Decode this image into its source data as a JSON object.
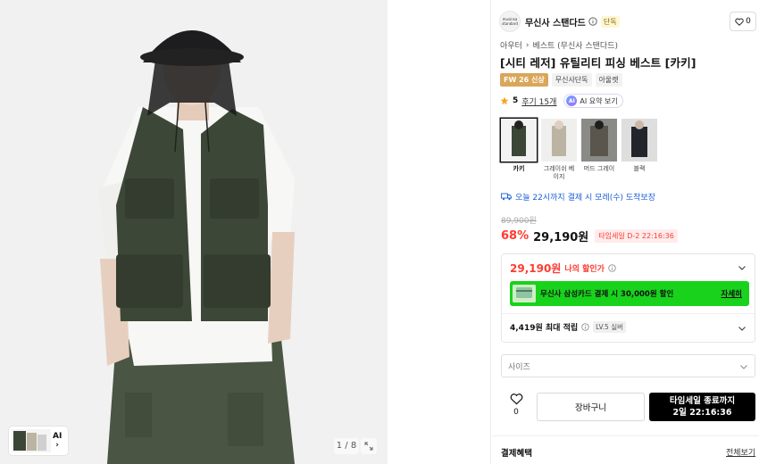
{
  "gallery": {
    "counter": "1 / 8",
    "thumb_ai_label": "AI"
  },
  "brand": {
    "logo_text": "musinsa standard",
    "name": "무신사 스탠다드",
    "exclusive_badge": "단독",
    "like_count": "0"
  },
  "breadcrumb": {
    "items": [
      "아우터",
      "베스트 (무신사 스탠다드)"
    ]
  },
  "product": {
    "title": "[시티 레저] 유틸리티 피싱 베스트 [카키]",
    "tags": [
      "FW 26 신상",
      "무신사단독",
      "아울렛"
    ],
    "rating": "5",
    "reviews": "후기 15개",
    "ai_summary": "AI 요약 보기",
    "ai_icon": "AI"
  },
  "colors": [
    {
      "label": "카키",
      "selected": true,
      "swatch": "#3b4636"
    },
    {
      "label": "그레이쉬 베이지",
      "selected": false,
      "swatch": "#bcb4a3"
    },
    {
      "label": "머드 그레이",
      "selected": false,
      "swatch": "#5a554d"
    },
    {
      "label": "블랙",
      "selected": false,
      "swatch": "#22252b"
    }
  ],
  "delivery": {
    "text": "오늘 22시까지 결제 시 모레(수) 도착보장"
  },
  "price": {
    "original": "89,900원",
    "discount": "68%",
    "sale": "29,190원",
    "timesale_badge": "타임세일 D-2 22:16:36"
  },
  "benefit_card": {
    "my_price": "29,190원",
    "my_price_label": "나의 할인가",
    "card_banner": "무신사 삼성카드 결제 시 30,000원 할인",
    "card_detail": "자세히",
    "points": "4,419원 최대 적립",
    "level": "LV.5 실버"
  },
  "size_select": {
    "placeholder": "사이즈"
  },
  "actions": {
    "like_count": "0",
    "cart": "장바구니",
    "buy_line1": "타임세일 종료까지",
    "buy_line2": "2일 22:16:36"
  },
  "benefits": {
    "title": "결제혜택",
    "view_all": "전체보기"
  },
  "colors_theme": {
    "accent_red": "#ff3b30",
    "card_green": "#18d21c",
    "link_blue": "#1a5fd8"
  }
}
